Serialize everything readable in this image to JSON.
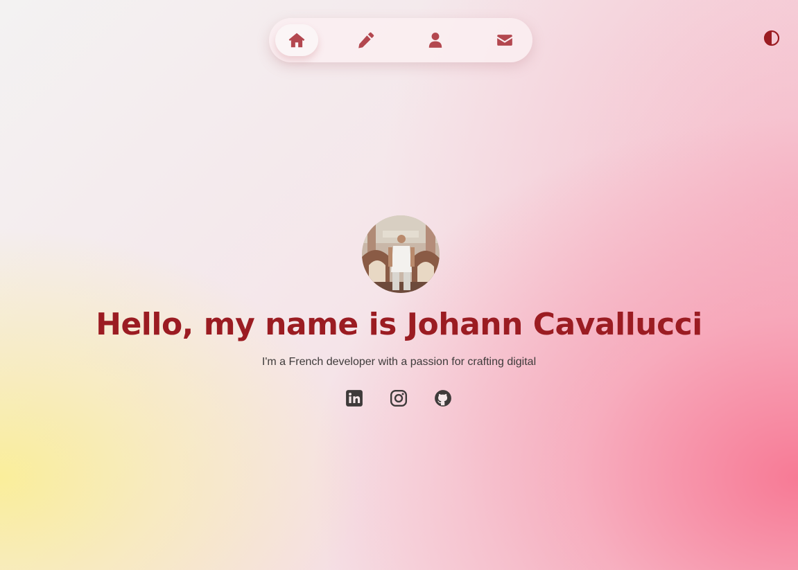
{
  "nav": {
    "items": [
      {
        "icon": "home-icon",
        "active": true
      },
      {
        "icon": "pencil-icon",
        "active": false
      },
      {
        "icon": "user-icon",
        "active": false
      },
      {
        "icon": "envelope-icon",
        "active": false
      }
    ]
  },
  "theme_toggle": {
    "icon": "contrast-icon"
  },
  "hero": {
    "headline": "Hello, my name is Johann Cavallucci",
    "tagline": "I'm a French developer with a passion for crafting digital"
  },
  "socials": [
    {
      "icon": "linkedin-icon"
    },
    {
      "icon": "instagram-icon"
    },
    {
      "icon": "github-icon"
    }
  ],
  "colors": {
    "accent": "#9b1c22",
    "nav_icon": "#b3474f",
    "text": "#3e3a3a",
    "gradient_yellow": "#f9ee96",
    "gradient_pink": "#f7768f"
  }
}
